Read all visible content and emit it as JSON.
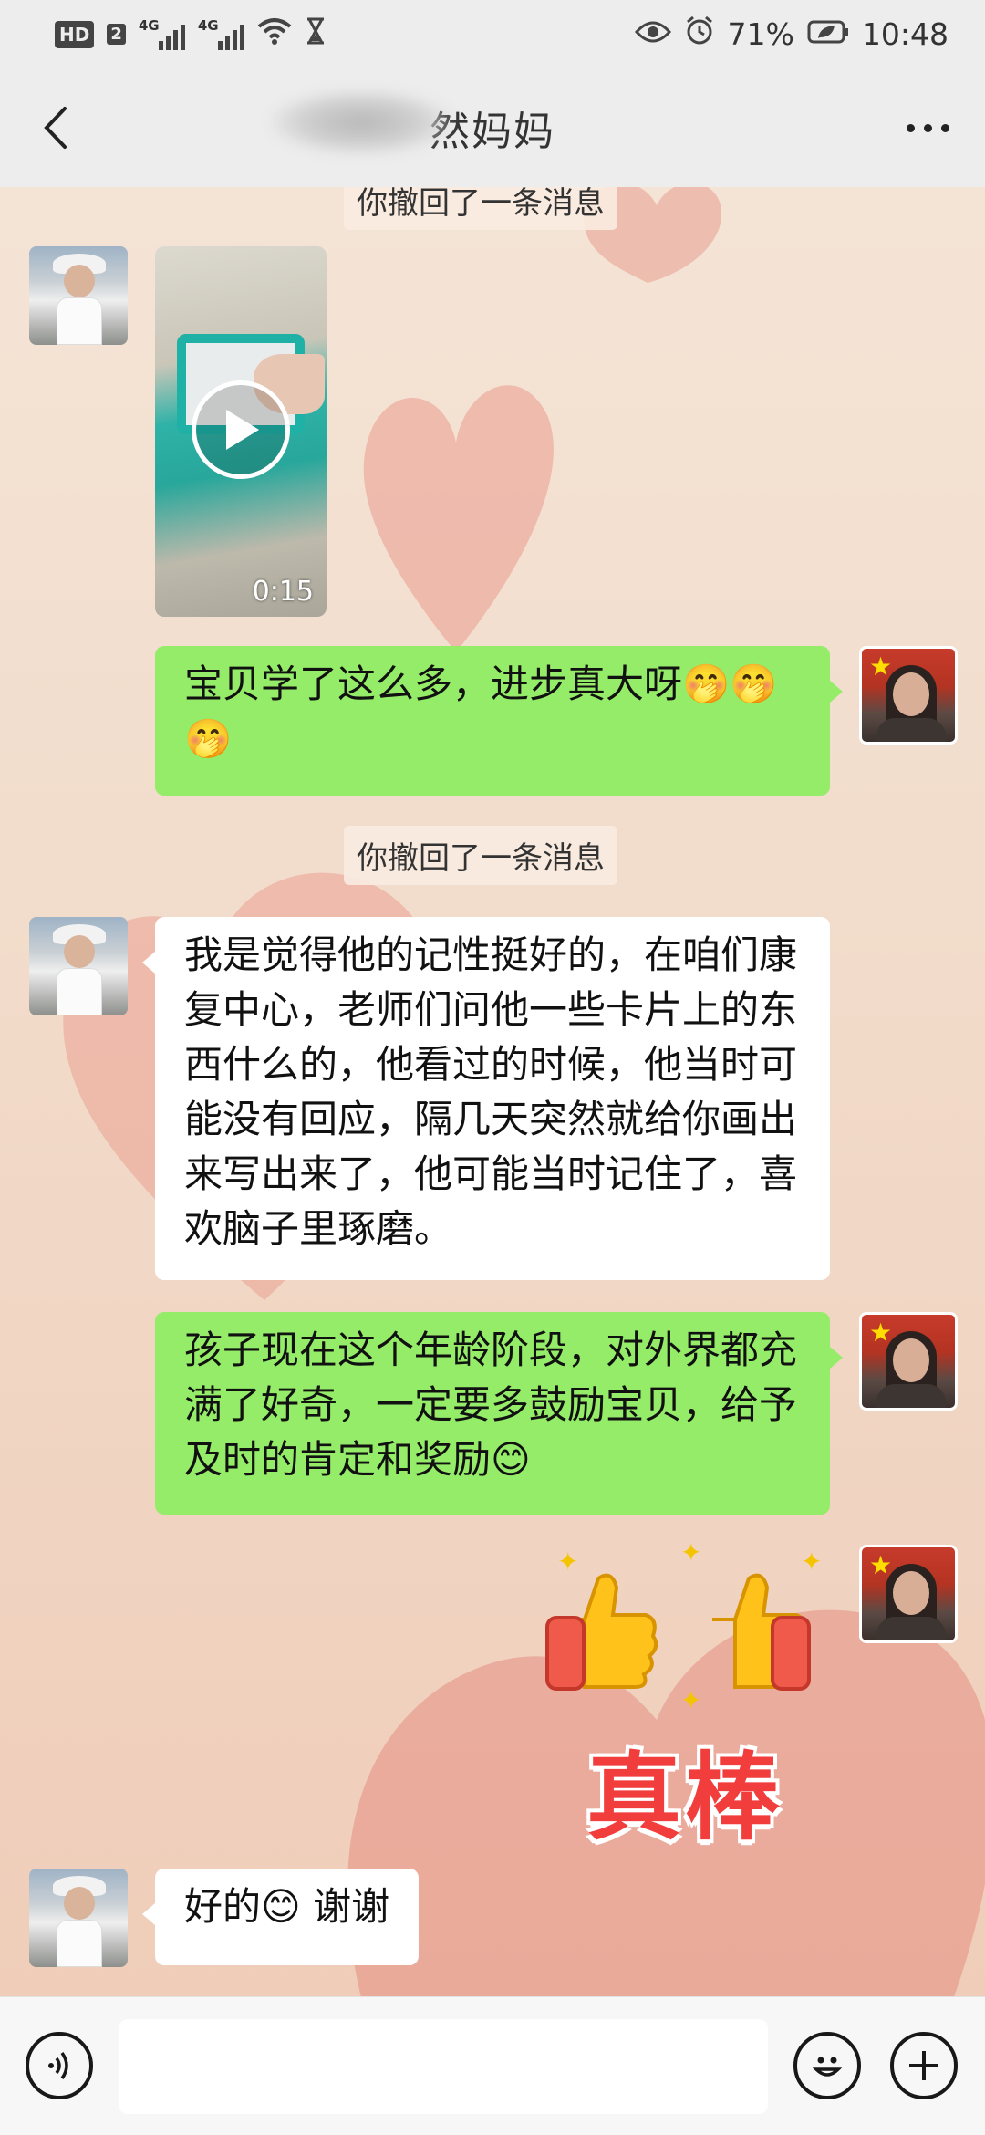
{
  "status_bar": {
    "hd": "HD",
    "sim": "2",
    "network1": "4G",
    "network2": "4G",
    "battery_pct": "71%",
    "time": "10:48"
  },
  "header": {
    "title": "然妈妈",
    "back_icon": "chevron-left-icon",
    "more_icon": "more-dots-icon"
  },
  "messages": {
    "recalled_top": "你撤回了一条消息",
    "video_duration": "0:15",
    "msg1": "宝贝学了这么多，进步真大呀🤭🤭🤭",
    "recalled_mid": "你撤回了一条消息",
    "msg2": "我是觉得他的记性挺好的，在咱们康复中心，老师们问他一些卡片上的东西什么的，他看过的时候，他当时可能没有回应，隔几天突然就给你画出来写出来了，他可能当时记住了，喜欢脑子里琢磨。",
    "msg3": "孩子现在这个年龄阶段，对外界都充满了好奇，一定要多鼓励宝贝，给予及时的肯定和奖励😊",
    "sticker_text": "真棒",
    "msg4": "好的😊 谢谢"
  },
  "input_bar": {
    "voice_icon": "voice-icon",
    "emoji_icon": "emoji-icon",
    "plus_icon": "plus-icon",
    "input_value": ""
  },
  "colors": {
    "self_bubble": "#95ec69",
    "other_bubble": "#ffffff",
    "chrome": "#ededed",
    "sticker_red": "#f23d3d"
  }
}
